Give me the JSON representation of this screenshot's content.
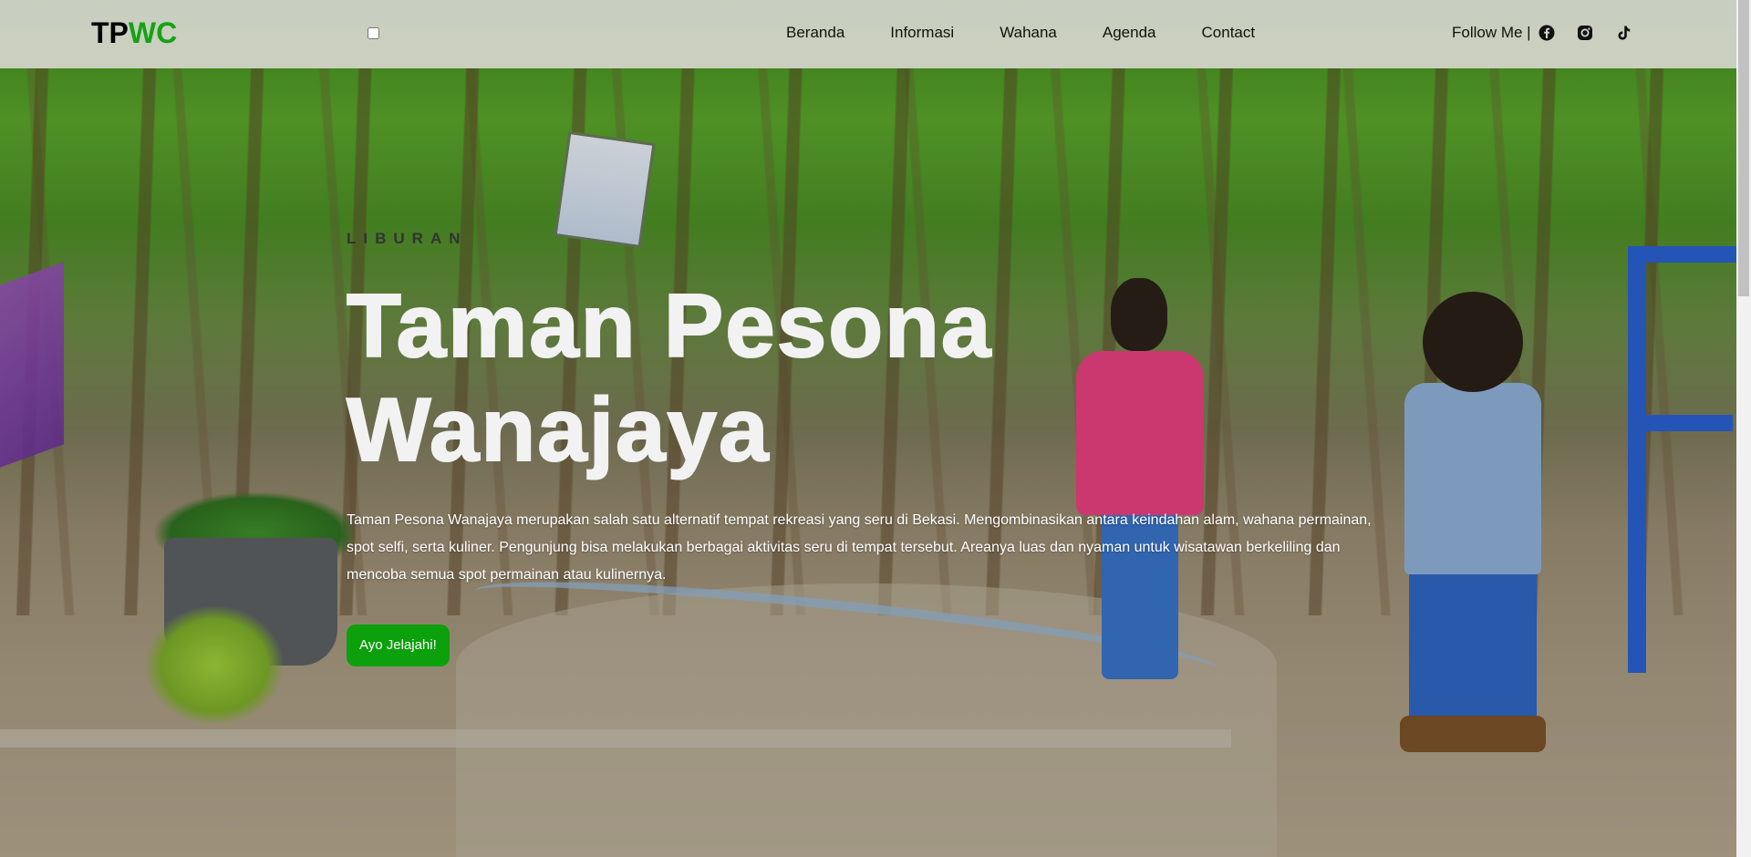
{
  "header": {
    "logo_part1": "TP",
    "logo_part2": "WC",
    "nav": [
      {
        "label": "Beranda"
      },
      {
        "label": "Informasi"
      },
      {
        "label": "Wahana"
      },
      {
        "label": "Agenda"
      },
      {
        "label": "Contact"
      }
    ],
    "follow_label": "Follow Me |",
    "social_icons": [
      "facebook-icon",
      "instagram-icon",
      "tiktok-icon"
    ]
  },
  "hero": {
    "eyebrow": "LIBURAN",
    "title": "Taman Pesona Wanajaya",
    "description": "Taman Pesona Wanajaya merupakan salah satu alternatif tempat rekreasi yang seru di Bekasi. Mengombinasikan antara keindahan alam, wahana permainan, spot selfi, serta kuliner. Pengunjung bisa melakukan berbagai aktivitas seru di tempat tersebut. Areanya luas dan nyaman untuk wisatawan berkeliling dan mencoba semua spot permainan atau kulinernya.",
    "cta_label": "Ayo Jelajahi!"
  },
  "colors": {
    "logo_accent": "#13a313",
    "cta_background": "#0ca00c",
    "header_background": "#d6d6ce"
  }
}
